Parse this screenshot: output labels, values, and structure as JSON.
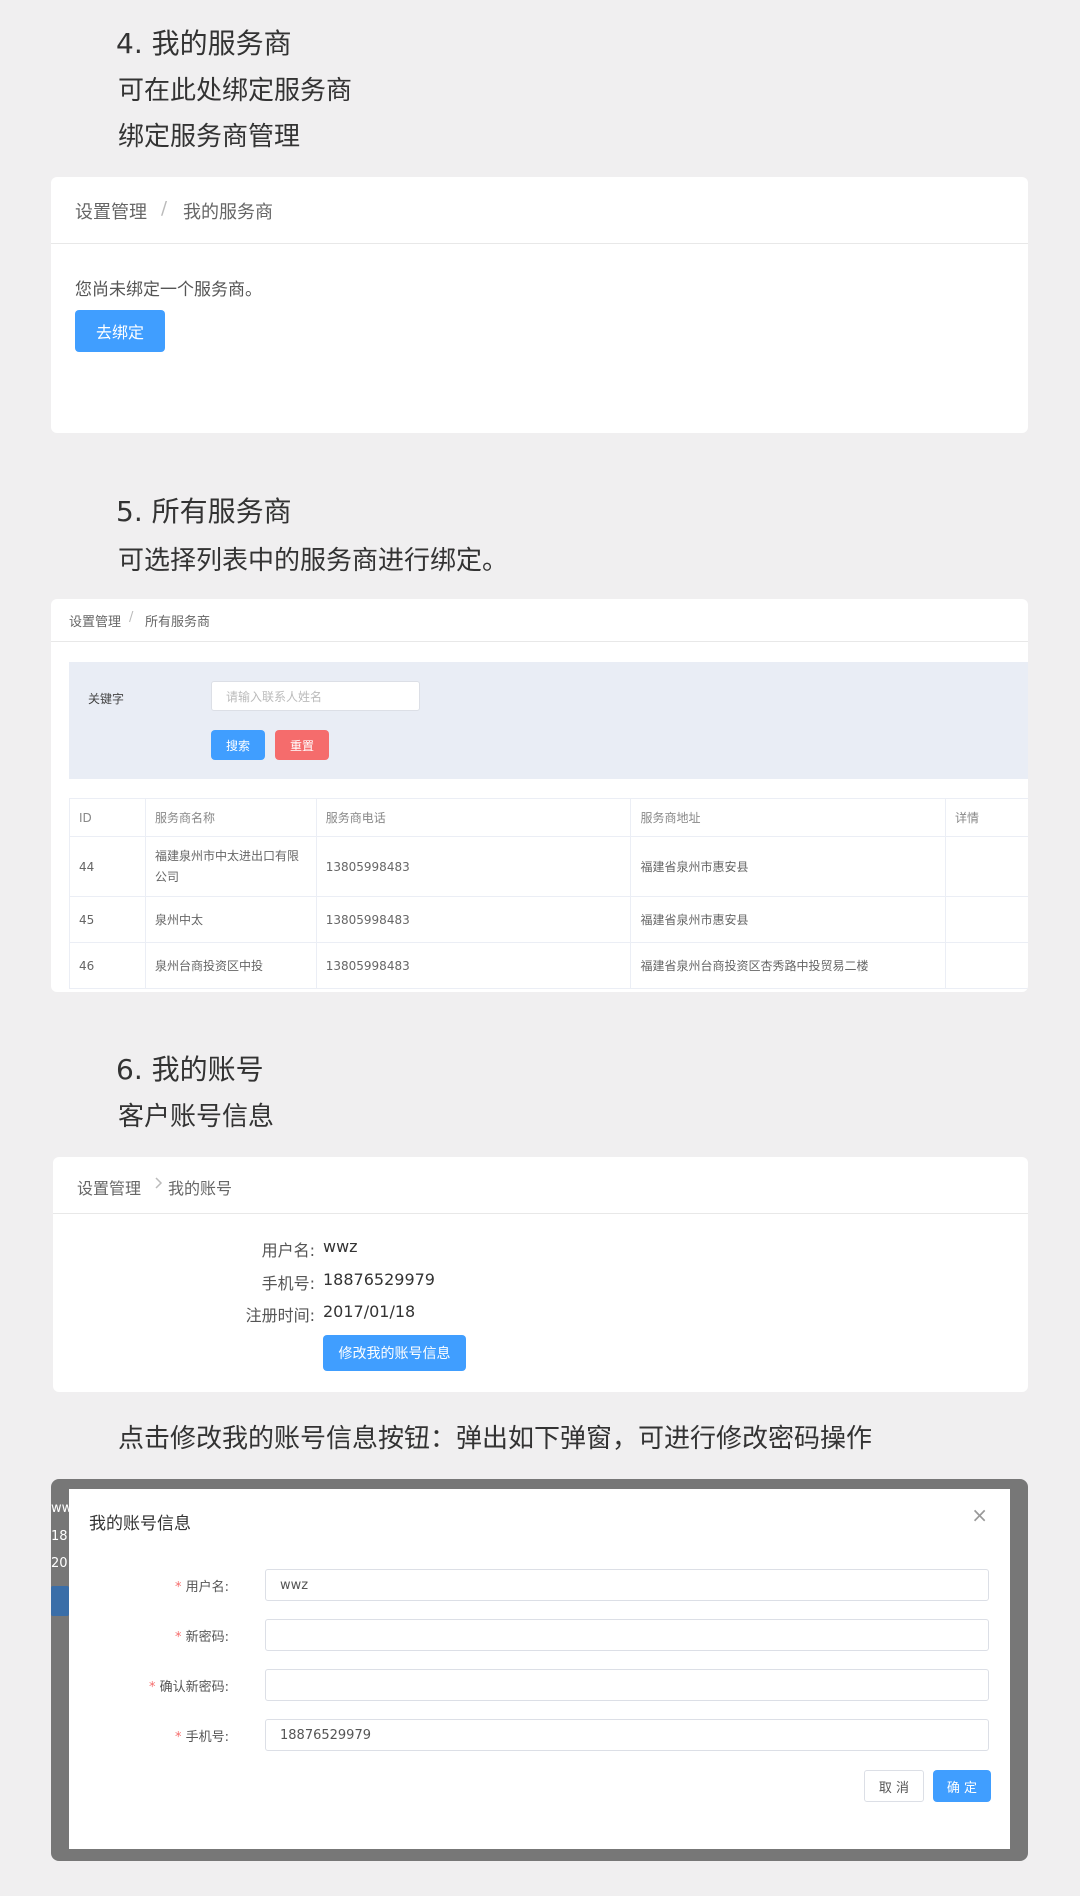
{
  "sec4": {
    "heading": "4. 我的服务商",
    "line1": "可在此处绑定服务商",
    "line2": "绑定服务商管理",
    "crumb_root": "设置管理",
    "crumb_sep": "/",
    "crumb_current": "我的服务商",
    "message": "您尚未绑定一个服务商。",
    "bind_button": "去绑定"
  },
  "sec5": {
    "heading": "5. 所有服务商",
    "line1": "可选择列表中的服务商进行绑定。",
    "crumb_root": "设置管理",
    "crumb_sep": "/",
    "crumb_current": "所有服务商",
    "keyword_label": "关键字",
    "keyword_placeholder": "请输入联系人姓名",
    "search_button": "搜索",
    "reset_button": "重置",
    "columns": [
      "ID",
      "服务商名称",
      "服务商电话",
      "服务商地址",
      "详情"
    ],
    "rows": [
      {
        "id": "44",
        "name": "福建泉州市中太进出口有限公司",
        "phone": "13805998483",
        "address": "福建省泉州市惠安县",
        "detail": ""
      },
      {
        "id": "45",
        "name": "泉州中太",
        "phone": "13805998483",
        "address": "福建省泉州市惠安县",
        "detail": ""
      },
      {
        "id": "46",
        "name": "泉州台商投资区中投",
        "phone": "13805998483",
        "address": "福建省泉州台商投资区杏秀路中投贸易二楼",
        "detail": ""
      }
    ]
  },
  "sec6": {
    "heading": "6. 我的账号",
    "line1": "客户账号信息",
    "crumb_root": "设置管理",
    "crumb_current": "我的账号",
    "username_label": "用户名:",
    "username": "wwz",
    "phone_label": "手机号:",
    "phone": "18876529979",
    "regtime_label": "注册时间:",
    "regtime": "2017/01/18",
    "edit_button": "修改我的账号信息",
    "note": "点击修改我的账号信息按钮：弹出如下弹窗，可进行修改密码操作"
  },
  "modal": {
    "behind_1": "ww",
    "behind_2": "18",
    "behind_3": "20",
    "title": "我的账号信息",
    "close": "×",
    "required_mark": "*",
    "username_label": "用户名:",
    "username_value": "wwz",
    "newpwd_label": "新密码:",
    "newpwd_value": "",
    "confirm_label": "确认新密码:",
    "confirm_value": "",
    "phone_label": "手机号:",
    "phone_value": "18876529979",
    "cancel_button": "取 消",
    "ok_button": "确 定"
  }
}
